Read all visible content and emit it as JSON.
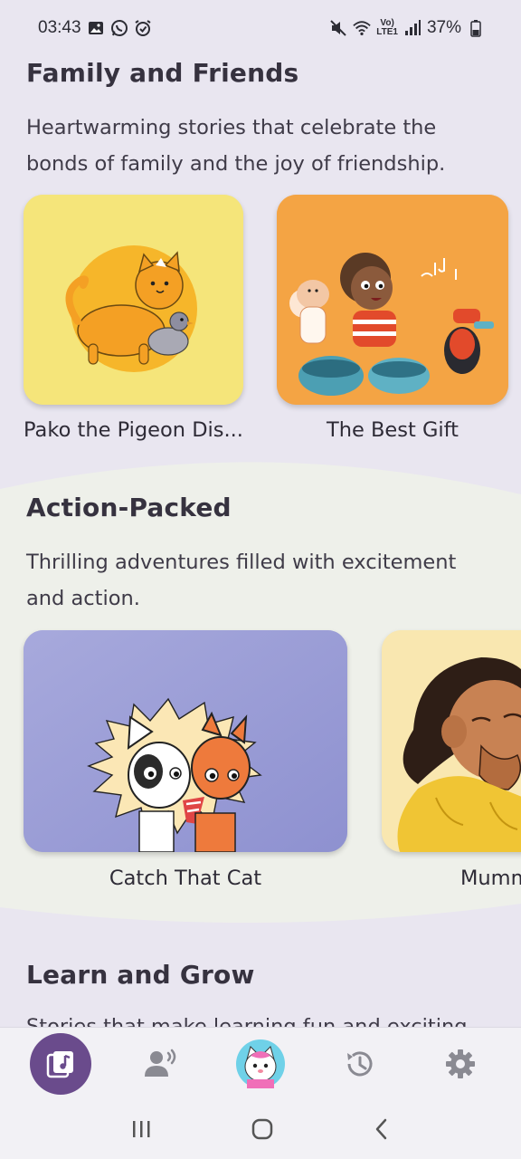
{
  "status_bar": {
    "time": "03:43",
    "battery": "37%",
    "icons_left": [
      "gallery-icon",
      "whatsapp-icon",
      "alarm-icon"
    ],
    "icons_right": [
      "mute-icon",
      "wifi-icon",
      "volte-icon",
      "signal-icon",
      "battery-icon"
    ]
  },
  "sections": [
    {
      "title": "Family and Friends",
      "description": "Heartwarming stories that celebrate the bonds of family and the joy of friendship.",
      "books": [
        {
          "title": "Pako the Pigeon Dis..."
        },
        {
          "title": "The Best Gift"
        }
      ]
    },
    {
      "title": "Action-Packed",
      "description": "Thrilling adventures filled with excitement and action.",
      "books": [
        {
          "title": "Catch That Cat"
        },
        {
          "title": "Mumm"
        }
      ]
    },
    {
      "title": "Learn and Grow",
      "description": "Stories that make learning fun and exciting"
    }
  ],
  "bottom_nav": {
    "items": [
      "library-icon",
      "read-aloud-icon",
      "profile-avatar-icon",
      "history-icon",
      "settings-icon"
    ],
    "active": "library-icon"
  },
  "colors": {
    "background": "#e9e6f0",
    "wave_section": "#eef0ea",
    "accent": "#6a4b8c",
    "card_yellow": "#f5e57a",
    "card_orange": "#f4a444",
    "card_lavender": "#9ea0d8"
  }
}
